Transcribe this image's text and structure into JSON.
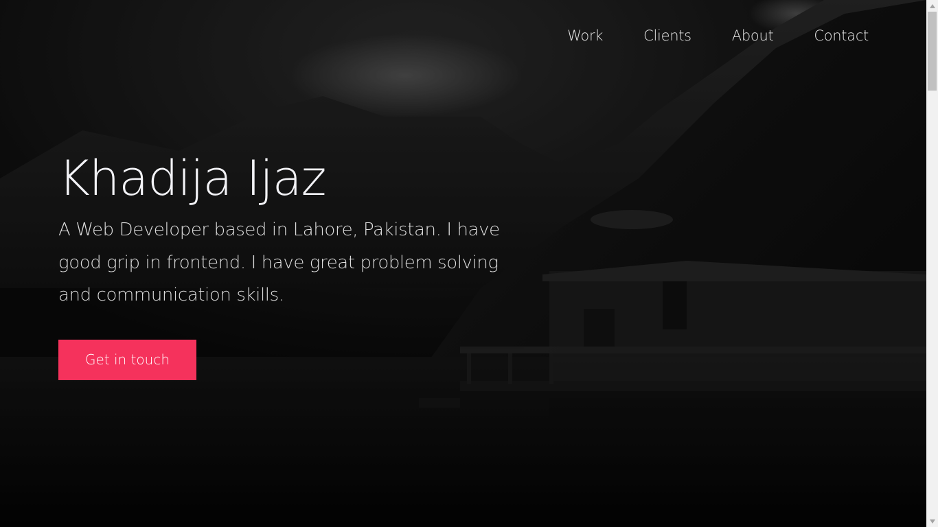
{
  "nav": {
    "items": [
      {
        "label": "Work"
      },
      {
        "label": "Clients"
      },
      {
        "label": "About"
      },
      {
        "label": "Contact"
      }
    ]
  },
  "hero": {
    "title": "Khadija Ijaz",
    "description": "A Web Developer based in Lahore, Pakistan. I have good grip in frontend. I have great problem solving and communication skills.",
    "cta_label": "Get in touch"
  },
  "colors": {
    "accent": "#f5325c",
    "background": "#050505",
    "text": "#f3f3f7"
  },
  "icons": {
    "scroll_up": "triangle-up-icon",
    "scroll_down": "triangle-down-icon"
  }
}
